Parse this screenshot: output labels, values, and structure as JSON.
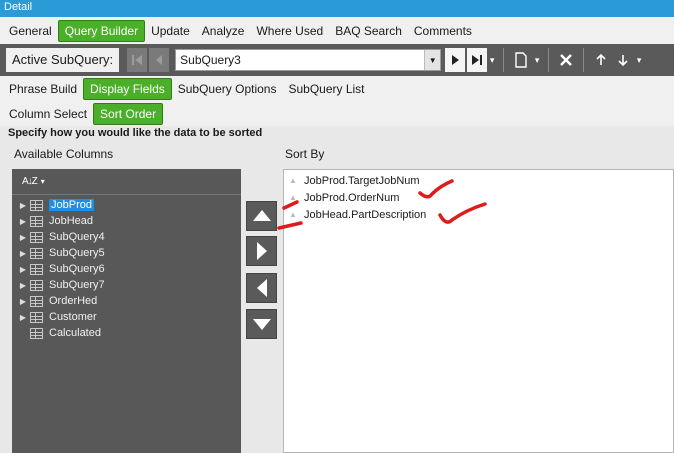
{
  "window": {
    "title": "Detail"
  },
  "main_tabs": [
    {
      "label": "General",
      "active": false
    },
    {
      "label": "Query Builder",
      "active": true
    },
    {
      "label": "Update",
      "active": false
    },
    {
      "label": "Analyze",
      "active": false
    },
    {
      "label": "Where Used",
      "active": false
    },
    {
      "label": "BAQ Search",
      "active": false
    },
    {
      "label": "Comments",
      "active": false
    }
  ],
  "subquery_bar": {
    "label": "Active SubQuery:",
    "selected": "SubQuery3"
  },
  "query_tabs": [
    {
      "label": "Phrase Build",
      "active": false
    },
    {
      "label": "Display Fields",
      "active": true
    },
    {
      "label": "SubQuery Options",
      "active": false
    },
    {
      "label": "SubQuery List",
      "active": false
    }
  ],
  "field_tabs": [
    {
      "label": "Column Select",
      "active": false
    },
    {
      "label": "Sort Order",
      "active": true
    }
  ],
  "instructions": "Specify how you would like the data to be sorted",
  "available": {
    "label": "Available Columns",
    "sort_glyph": "A↓Z",
    "items": [
      {
        "label": "JobProd",
        "expandable": true,
        "selected": true
      },
      {
        "label": "JobHead",
        "expandable": true,
        "selected": false
      },
      {
        "label": "SubQuery4",
        "expandable": true,
        "selected": false
      },
      {
        "label": "SubQuery5",
        "expandable": true,
        "selected": false
      },
      {
        "label": "SubQuery6",
        "expandable": true,
        "selected": false
      },
      {
        "label": "SubQuery7",
        "expandable": true,
        "selected": false
      },
      {
        "label": "OrderHed",
        "expandable": true,
        "selected": false
      },
      {
        "label": "Customer",
        "expandable": true,
        "selected": false
      },
      {
        "label": "Calculated",
        "expandable": false,
        "selected": false
      }
    ]
  },
  "sort_by": {
    "label": "Sort By",
    "items": [
      {
        "label": "JobProd.TargetJobNum"
      },
      {
        "label": "JobProd.OrderNum"
      },
      {
        "label": "JobHead.PartDescription"
      }
    ]
  },
  "colors": {
    "active_tab": "#4caf2a",
    "titlebar": "#2b9bd8",
    "dark_panel": "#585858",
    "selection": "#1f8fe0",
    "annotation": "#e01b1b"
  }
}
